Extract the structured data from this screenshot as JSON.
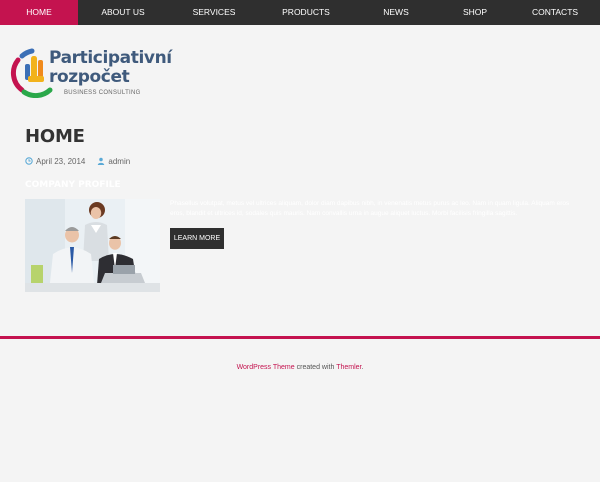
{
  "colors": {
    "accent": "#c4134f",
    "nav_bg": "#2f2f2f",
    "page_bg": "#f4f4f4"
  },
  "nav": {
    "items": [
      {
        "label": "HOME",
        "active": true
      },
      {
        "label": "ABOUT US"
      },
      {
        "label": "SERVICES"
      },
      {
        "label": "PRODUCTS"
      },
      {
        "label": "NEWS"
      },
      {
        "label": "SHOP"
      },
      {
        "label": "CONTACTS"
      }
    ]
  },
  "logo": {
    "line1": "Participativní",
    "line2": "rozpočet",
    "tagline": "BUSINESS CONSULTING"
  },
  "post": {
    "title": "HOME",
    "date": "April 23, 2014",
    "author": "admin",
    "date_icon": "clock-icon",
    "author_icon": "user-icon"
  },
  "content": {
    "section_title": "COMPANY PROFILE",
    "description": "Phasellus volutpat, metus vel ultrices aliquam, dolor diam dapibus nibh, in venenatis metus purus ac leo. Nam in quam ligula. Aliquam eros eros, blandit et ultrices id, sodales quis mauris. Nam convallis urna in augue aliquet luctus. Morbi facilisis fringilla sagittis.",
    "button_label": "LEARN MORE",
    "photo": "business-team-photo"
  },
  "footer": {
    "link1": "WordPress Theme",
    "middle": " created with ",
    "link2": "Themler",
    "end": "."
  }
}
